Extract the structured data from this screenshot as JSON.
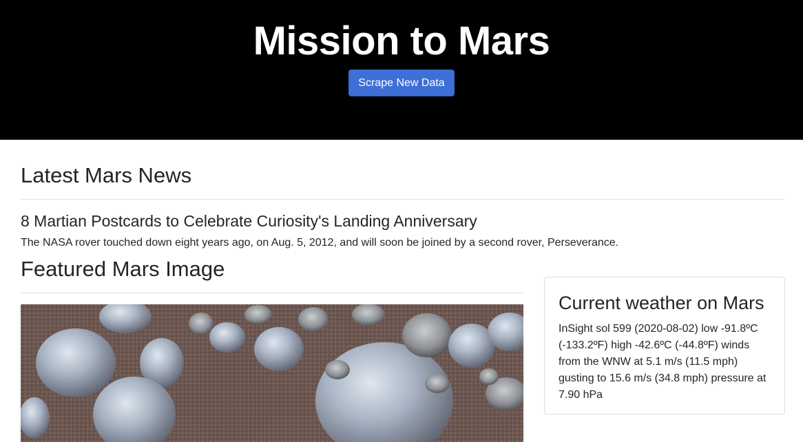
{
  "header": {
    "title": "Mission to Mars",
    "scrape_button": "Scrape New Data"
  },
  "news": {
    "section_title": "Latest Mars News",
    "title": "8 Martian Postcards to Celebrate Curiosity's Landing Anniversary",
    "teaser": "The NASA rover touched down eight years ago, on Aug. 5, 2012, and will soon be joined by a second rover, Perseverance."
  },
  "featured": {
    "section_title": "Featured Mars Image"
  },
  "weather": {
    "title": "Current weather on Mars",
    "text": "InSight sol 599 (2020-08-02) low -91.8ºC (-133.2ºF) high -42.6ºC (-44.8ºF) winds from the WNW at 5.1 m/s (11.5 mph) gusting to 15.6 m/s (34.8 mph) pressure at 7.90 hPa"
  },
  "colors": {
    "header_bg": "#000000",
    "button_bg": "#3e6fd6"
  }
}
